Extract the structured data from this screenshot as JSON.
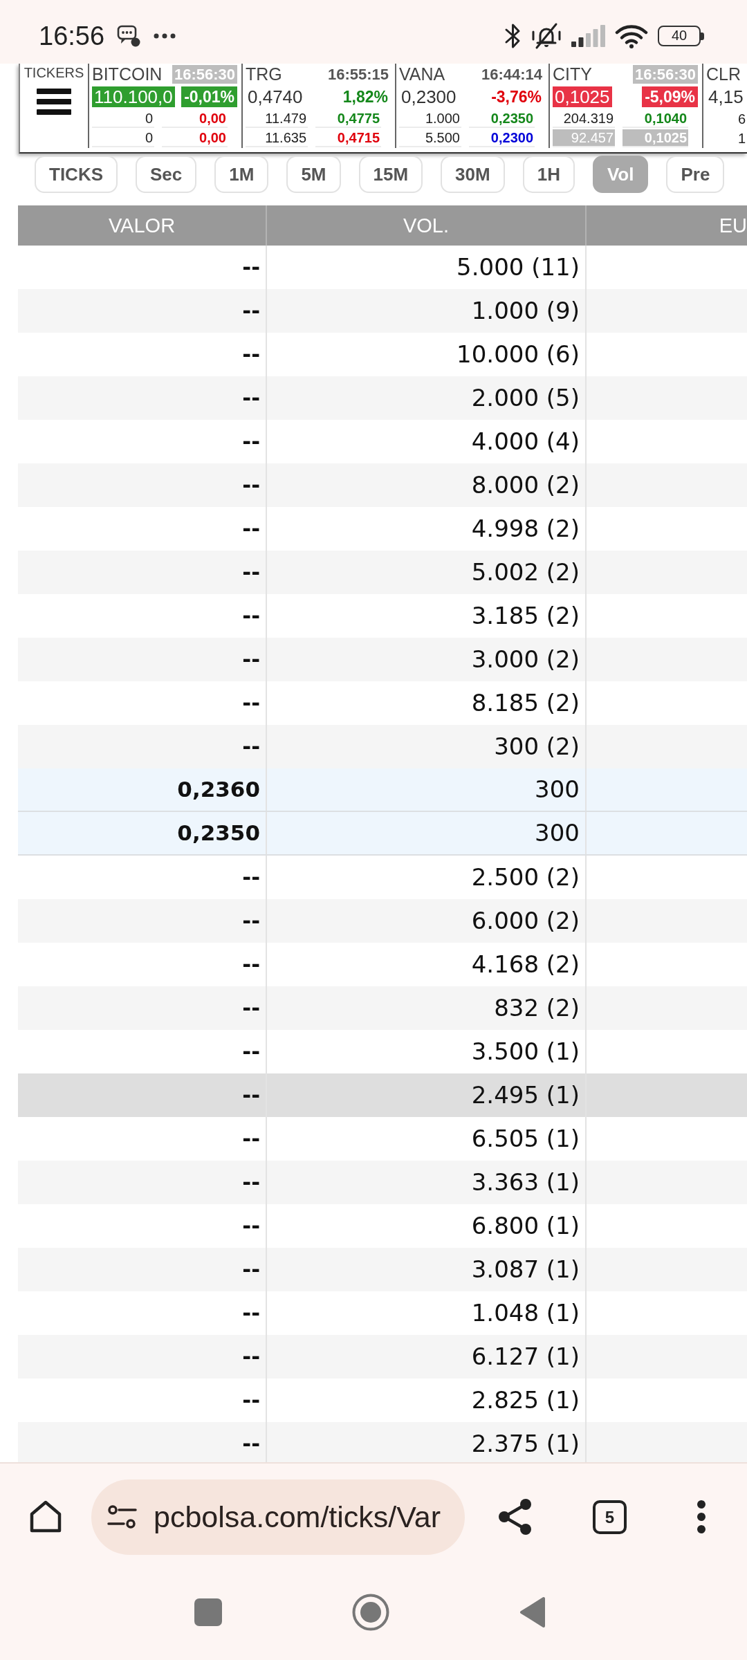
{
  "status_bar": {
    "time": "16:56",
    "battery": "40"
  },
  "ticker_panel": {
    "label": "TICKERS",
    "tickers": [
      {
        "name": "BITCOIN",
        "time": "16:56:30",
        "time_updated": true,
        "price": {
          "text": "110.100,0",
          "highlighted": true,
          "color": "#2f9e2f"
        },
        "change": {
          "text": "-0,01%",
          "highlighted": true,
          "color": "#2f9e2f"
        },
        "quotes": [
          {
            "volume": "0",
            "price": "0,00",
            "highlighted": false,
            "color": "#e0000c"
          },
          {
            "volume": "0",
            "price": "0,00",
            "highlighted": false,
            "color": "#e0000c"
          }
        ]
      },
      {
        "name": "TRG",
        "time": "16:55:15",
        "time_updated": false,
        "price": {
          "text": "0,4740",
          "highlighted": false
        },
        "change": {
          "text": "1,82%",
          "highlighted": false,
          "color": "#14871a"
        },
        "quotes": [
          {
            "volume": "11.479",
            "price": "0,4775",
            "highlighted": false,
            "color": "#14871a"
          },
          {
            "volume": "11.635",
            "price": "0,4715",
            "highlighted": false,
            "color": "#e0000c"
          }
        ]
      },
      {
        "name": "VANA",
        "time": "16:44:14",
        "time_updated": false,
        "price": {
          "text": "0,2300",
          "highlighted": false
        },
        "change": {
          "text": "-3,76%",
          "highlighted": false,
          "color": "#e0000c"
        },
        "quotes": [
          {
            "volume": "1.000",
            "price": "0,2350",
            "highlighted": false,
            "color": "#14871a"
          },
          {
            "volume": "5.500",
            "price": "0,2300",
            "highlighted": false,
            "color": "#0000d8"
          }
        ]
      },
      {
        "name": "CITY",
        "time": "16:56:30",
        "time_updated": true,
        "price": {
          "text": "0,1025",
          "highlighted": true,
          "color": "#e83346"
        },
        "change": {
          "text": "-5,09%",
          "highlighted": true,
          "color": "#e83346"
        },
        "quotes": [
          {
            "volume": "204.319",
            "price": "0,1040",
            "highlighted": false,
            "color": "#14871a"
          },
          {
            "volume": "92.457",
            "price": "0,1025",
            "highlighted": true,
            "color": "#bdbdbd"
          }
        ]
      },
      {
        "name": "CLR",
        "price": {
          "text": "4,15",
          "highlighted": false
        },
        "quotes": [
          {
            "volume": "6"
          },
          {
            "volume": "1"
          }
        ]
      }
    ]
  },
  "intervals": [
    {
      "label": "TICKS",
      "selected": false
    },
    {
      "label": "Sec",
      "selected": false
    },
    {
      "label": "1M",
      "selected": false
    },
    {
      "label": "5M",
      "selected": false
    },
    {
      "label": "15M",
      "selected": false
    },
    {
      "label": "30M",
      "selected": false
    },
    {
      "label": "1H",
      "selected": false
    },
    {
      "label": "Vol",
      "selected": true
    },
    {
      "label": "Pre",
      "selected": false
    }
  ],
  "table": {
    "columns": [
      "VALOR",
      "VOL.",
      "EU"
    ],
    "rows": [
      {
        "valor": "--",
        "vol": "5.000 (11)",
        "kind": "aggregate",
        "selected": false
      },
      {
        "valor": "--",
        "vol": "1.000 (9)",
        "kind": "aggregate",
        "selected": false
      },
      {
        "valor": "--",
        "vol": "10.000 (6)",
        "kind": "aggregate",
        "selected": false
      },
      {
        "valor": "--",
        "vol": "2.000 (5)",
        "kind": "aggregate",
        "selected": false
      },
      {
        "valor": "--",
        "vol": "4.000 (4)",
        "kind": "aggregate",
        "selected": false
      },
      {
        "valor": "--",
        "vol": "8.000 (2)",
        "kind": "aggregate",
        "selected": false
      },
      {
        "valor": "--",
        "vol": "4.998 (2)",
        "kind": "aggregate",
        "selected": false
      },
      {
        "valor": "--",
        "vol": "5.002 (2)",
        "kind": "aggregate",
        "selected": false
      },
      {
        "valor": "--",
        "vol": "3.185 (2)",
        "kind": "aggregate",
        "selected": false
      },
      {
        "valor": "--",
        "vol": "3.000 (2)",
        "kind": "aggregate",
        "selected": false
      },
      {
        "valor": "--",
        "vol": "8.185 (2)",
        "kind": "aggregate",
        "selected": false
      },
      {
        "valor": "--",
        "vol": "300 (2)",
        "kind": "aggregate",
        "selected": false
      },
      {
        "valor": "0,2360",
        "vol": "300",
        "kind": "quote",
        "selected": false
      },
      {
        "valor": "0,2350",
        "vol": "300",
        "kind": "quote",
        "selected": false
      },
      {
        "valor": "--",
        "vol": "2.500 (2)",
        "kind": "aggregate",
        "selected": false
      },
      {
        "valor": "--",
        "vol": "6.000 (2)",
        "kind": "aggregate",
        "selected": false
      },
      {
        "valor": "--",
        "vol": "4.168 (2)",
        "kind": "aggregate",
        "selected": false
      },
      {
        "valor": "--",
        "vol": "832 (2)",
        "kind": "aggregate",
        "selected": false
      },
      {
        "valor": "--",
        "vol": "3.500 (1)",
        "kind": "aggregate",
        "selected": false
      },
      {
        "valor": "--",
        "vol": "2.495 (1)",
        "kind": "aggregate",
        "selected": true
      },
      {
        "valor": "--",
        "vol": "6.505 (1)",
        "kind": "aggregate",
        "selected": false
      },
      {
        "valor": "--",
        "vol": "3.363 (1)",
        "kind": "aggregate",
        "selected": false
      },
      {
        "valor": "--",
        "vol": "6.800 (1)",
        "kind": "aggregate",
        "selected": false
      },
      {
        "valor": "--",
        "vol": "3.087 (1)",
        "kind": "aggregate",
        "selected": false
      },
      {
        "valor": "--",
        "vol": "1.048 (1)",
        "kind": "aggregate",
        "selected": false
      },
      {
        "valor": "--",
        "vol": "6.127 (1)",
        "kind": "aggregate",
        "selected": false
      },
      {
        "valor": "--",
        "vol": "2.825 (1)",
        "kind": "aggregate",
        "selected": false
      },
      {
        "valor": "--",
        "vol": "2.375 (1)",
        "kind": "aggregate",
        "selected": false
      }
    ]
  },
  "browser": {
    "url": "pcbolsa.com/ticks/Var",
    "tab_count": "5"
  }
}
